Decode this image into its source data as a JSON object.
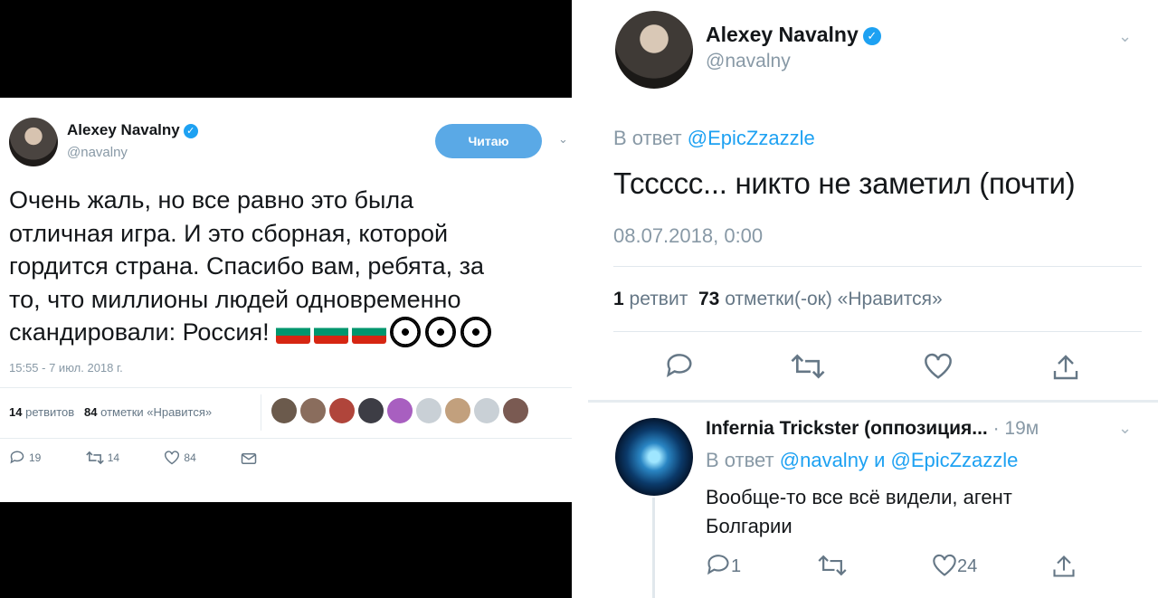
{
  "left": {
    "author": {
      "name": "Alexey Navalny",
      "handle": "@navalny",
      "verified": true
    },
    "follow_button": "Читаю",
    "text": "Очень жаль, но все равно это была\nотличная игра. И это сборная, которой\nгордится страна. Спасибо вам, ребята, за\nто, что миллионы людей одновременно\nскандировали: Россия! ",
    "emoji": [
      "flag-bulgaria",
      "flag-bulgaria",
      "flag-bulgaria",
      "soccer-ball",
      "soccer-ball",
      "soccer-ball"
    ],
    "timestamp": "15:55 - 7 июл. 2018 г.",
    "retweets_count": "14",
    "retweets_label": "ретвитов",
    "likes_count": "84",
    "likes_label": "отметки «Нравится»",
    "liker_avatars": 9,
    "actions": {
      "replies": "19",
      "retweets": "14",
      "likes": "84"
    }
  },
  "right": {
    "author": {
      "name": "Alexey Navalny",
      "handle": "@navalny",
      "verified": true
    },
    "reply_prefix": "В ответ",
    "reply_to": "@EpicZzazzle",
    "text": "Тссссс... никто не заметил (почти)",
    "timestamp": "08.07.2018, 0:00",
    "retweets_count": "1",
    "retweets_label": "ретвит",
    "likes_count": "73",
    "likes_label": "отметки(-ок) «Нравится»",
    "reply": {
      "author_name": "Infernia Trickster (оппозиция...",
      "age": "· 19м",
      "reply_prefix": "В ответ",
      "reply_to_1": "@navalny",
      "reply_and": "и",
      "reply_to_2": "@EpicZzazzle",
      "text": "Вообще-то все всё видели, агент Болгарии",
      "replies": "1",
      "likes": "24"
    }
  },
  "colors": {
    "accent": "#1da1f2",
    "follow_button": "#5aa9e6",
    "muted": "#8899a6"
  }
}
